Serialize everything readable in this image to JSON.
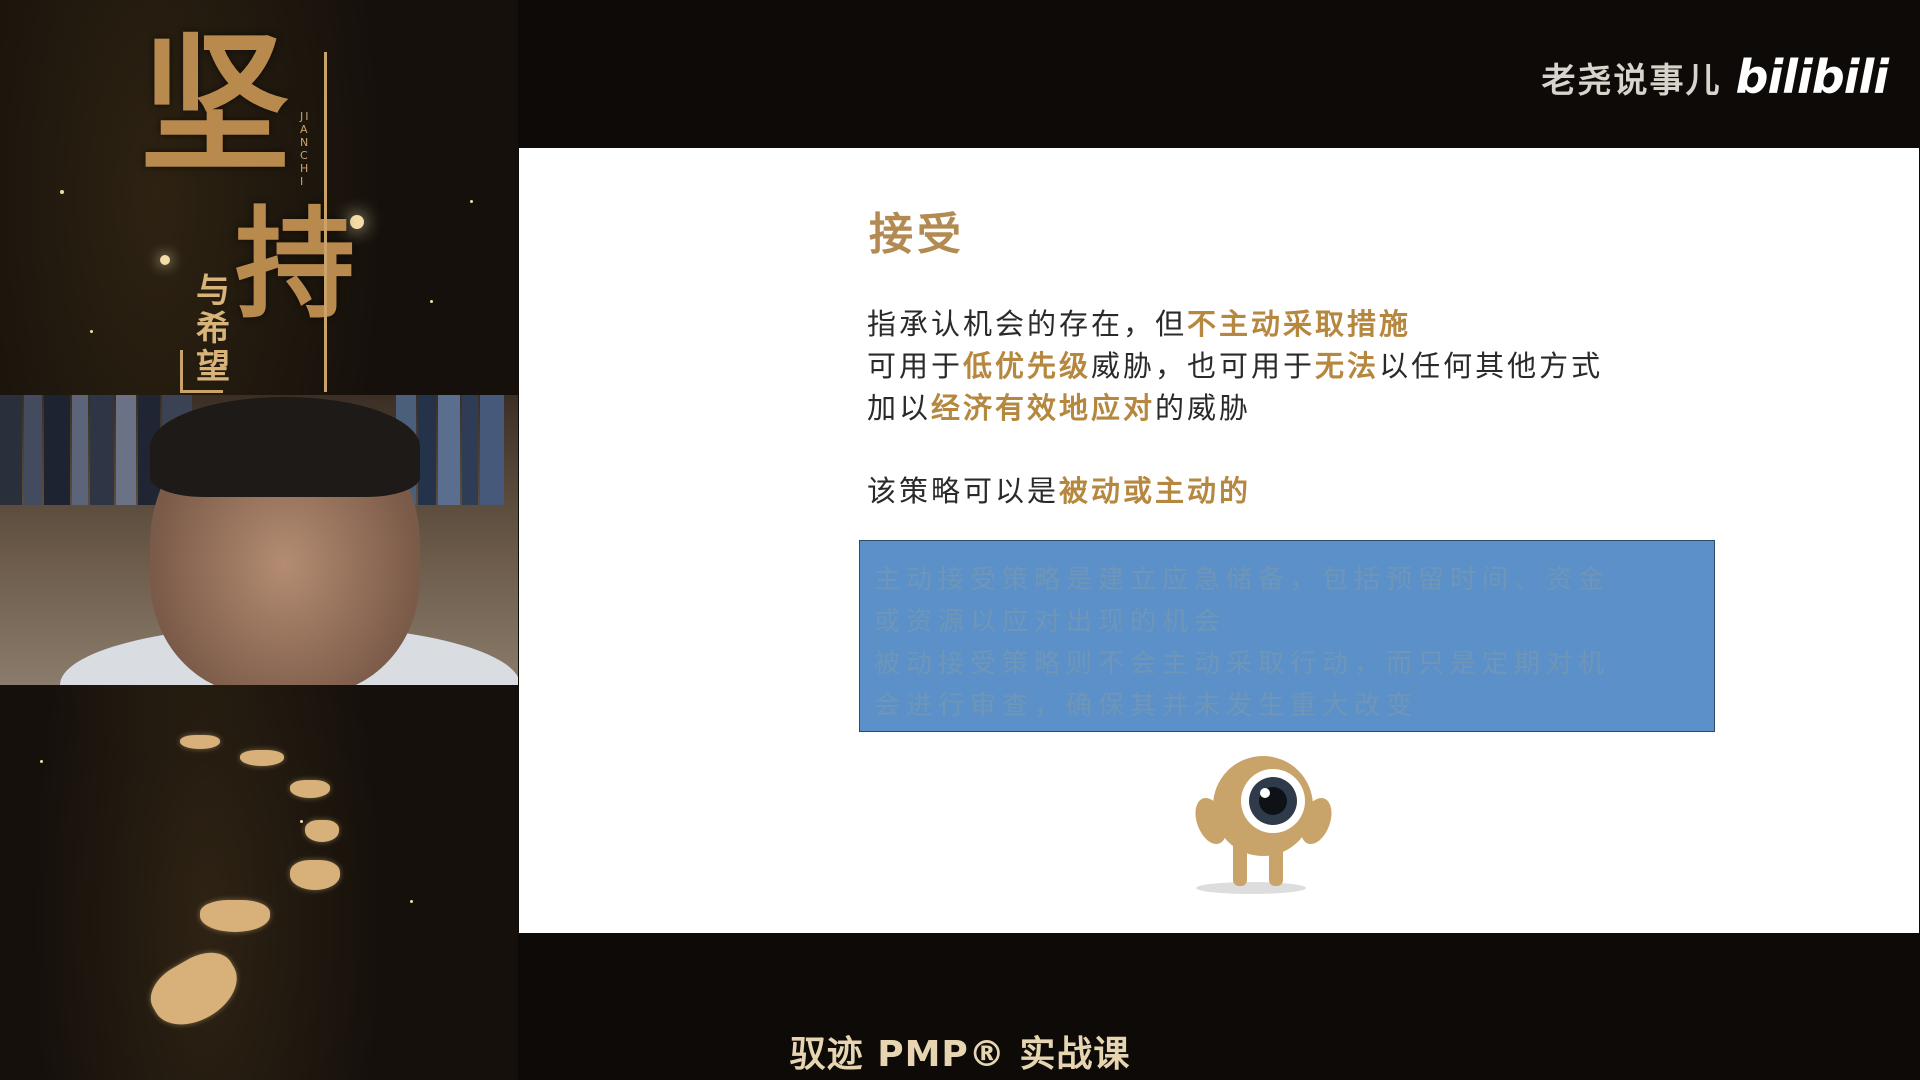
{
  "channel": {
    "name": "老尧说事儿",
    "logo_text": "bilibili"
  },
  "poster": {
    "title_char_1": "坚",
    "title_char_2": "持",
    "pinyin": "JIANCHI",
    "subtitle_chars": [
      "与",
      "希",
      "望"
    ]
  },
  "slide": {
    "title": "接受",
    "para_1": {
      "normal": "指承认机会的存在，但",
      "highlight": "不主动采取措施"
    },
    "para_2": {
      "part_1": "可用于",
      "highlight_1": "低优先级",
      "part_2": "威胁，也可用于",
      "highlight_2": "无法",
      "part_3": "以任何其他方式"
    },
    "para_3": {
      "part_1": "加以",
      "highlight": "经济有效地应对",
      "part_2": "的威胁"
    },
    "para_4": {
      "normal": "该策略可以是",
      "highlight": "被动或主动的"
    },
    "box_lines": [
      "主动接受策略是建立应急储备，包括预留时间、资金",
      "或资源以应对出现的机会",
      "被动接受策略则不会主动采取行动，而只是定期对机",
      "会进行审查，确保其并未发生重大改变"
    ],
    "mascot_icon": "eyeball-mascot-icon"
  },
  "footer": {
    "course_title": "驭迹 PMP® 实战课"
  },
  "colors": {
    "accent": "#b6873f",
    "box": "#5b90c8",
    "background": "#0d0a08"
  }
}
